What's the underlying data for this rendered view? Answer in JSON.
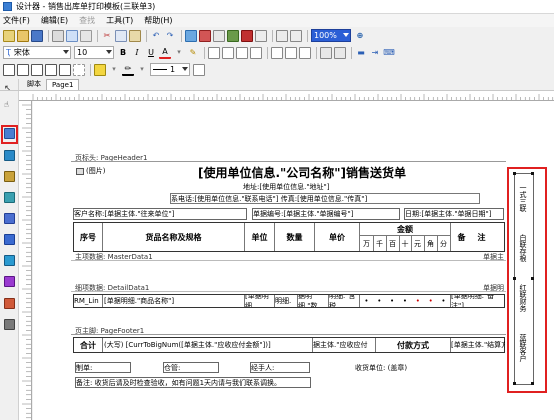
{
  "window": {
    "title": "设计器 - 销售出库单打印模板(三联单3)"
  },
  "menu": [
    "文件(F)",
    "编辑(E)",
    "查找",
    "工具(T)",
    "帮助(H)"
  ],
  "toolbar2": {
    "font": "宋体",
    "size": "10",
    "bold": "B",
    "italic": "I",
    "underline": "U",
    "fontcolor": "A"
  },
  "toolbar1": {
    "zoom": "100%"
  },
  "tabs": [
    "脚本",
    "Page1"
  ],
  "ruler_ticks": [
    "1",
    "2",
    "3",
    "4",
    "5",
    "6",
    "7",
    "8",
    "9",
    "10",
    "11",
    "12",
    "13",
    "14",
    "15",
    "16",
    "17",
    "18",
    "19",
    "20"
  ],
  "report": {
    "band_page_header": "页标头: PageHeader1",
    "image_label": "(图片)",
    "title": "[使用单位信息.\"公司名称\"]销售送货单",
    "address": "地址:[使用单位信息.\"地址\"]",
    "contact": "系电话:[使用单位信息.\"联系电话\"]  传真:[使用单位信息.\"传真\"]",
    "customer": "客户名称:[单据主体.\"往来单位\"]",
    "doc_no": "单据编号:[单据主体.\"单据编号\"]",
    "date": "日期:[单据主体.\"单据日期\"]",
    "headers": {
      "seq": "序号",
      "product": "货品名称及规格",
      "unit": "单位",
      "qty": "数量",
      "price": "单价",
      "amount": "金额",
      "note": "备注"
    },
    "amount_digits": [
      "万",
      "千",
      "百",
      "十",
      "元",
      "角",
      "分"
    ],
    "band_master": "主项数据: MasterData1",
    "band_master_right": "单据主",
    "band_detail": "细项数据: DetailData1",
    "band_detail_right": "单据明",
    "detail_cells": [
      "RM_Lin",
      "[单据明细.\"商品名称\"]",
      "[单据明细.",
      "明细.",
      "据明细.\"数",
      "明细.\"含税",
      "[单据明细.\"备注\"]"
    ],
    "band_page_footer": "页主脚: PageFooter1",
    "footer": {
      "total": "合计",
      "bigtotal": "(大写) [CurrToBigNum([单据主体.\"应收应付金额\"])]",
      "amount_ref": "据主体.\"应收应付",
      "pay_label": "付款方式",
      "pay_value": "[单据主体.\"结算方",
      "maker": "制单:",
      "keeper": "仓管:",
      "handler": "经手人:",
      "receiver": "收货单位: (盖章)",
      "notice": "备注: 收货后请及时检查验收，如有问题1天内请与我们联系调换。"
    },
    "side_text": [
      "一式三联",
      "白联存根",
      "红联财务",
      "蓝联客户"
    ]
  }
}
